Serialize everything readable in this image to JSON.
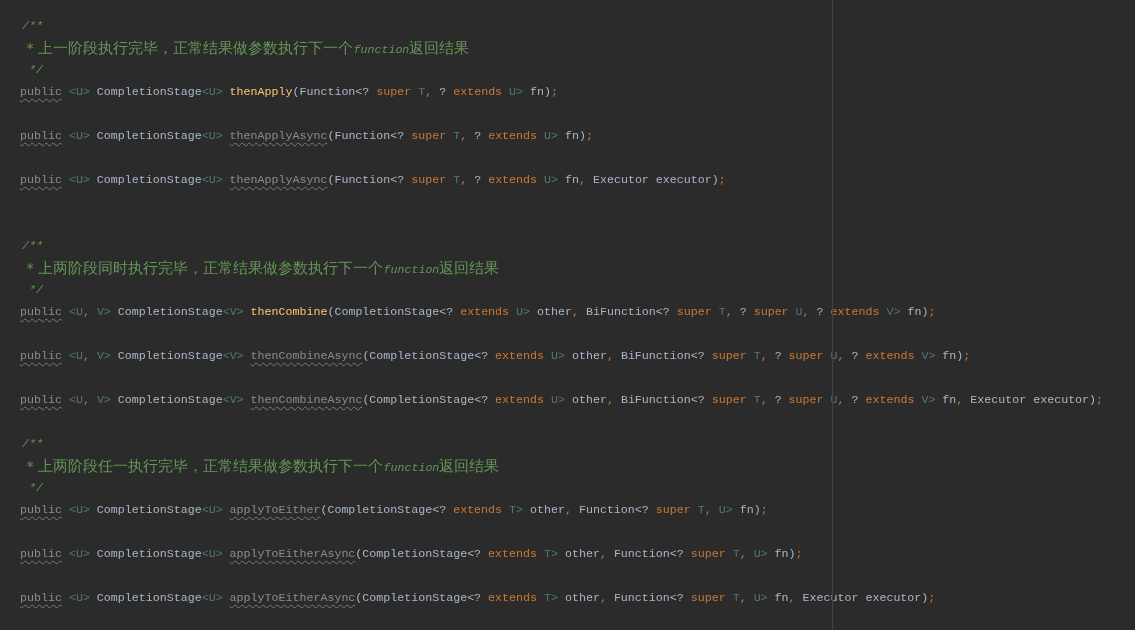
{
  "editor": {
    "lines": [
      {
        "kind": "comment",
        "tokens": [
          {
            "text": "/**",
            "kind": "comment_em"
          }
        ]
      },
      {
        "kind": "comment",
        "tokens": [
          {
            "text": " * 上一阶段执行完毕，正常结果做参数执行下一个",
            "kind": "comment"
          },
          {
            "text": "function",
            "kind": "comment_em"
          },
          {
            "text": "返回结果",
            "kind": "comment"
          }
        ]
      },
      {
        "kind": "comment",
        "tokens": [
          {
            "text": " */",
            "kind": "comment_em"
          }
        ]
      },
      {
        "kind": "code",
        "tokens": [
          {
            "text": "public",
            "kind": "warn"
          },
          {
            "text": " <U>",
            "kind": "type"
          },
          {
            "text": " CompletionStage",
            "kind": "plain"
          },
          {
            "text": "<U> ",
            "kind": "type"
          },
          {
            "text": "thenApply",
            "kind": "method"
          },
          {
            "text": "(Function<? ",
            "kind": "plain"
          },
          {
            "text": "super",
            "kind": "kw"
          },
          {
            "text": " T",
            "kind": "type"
          },
          {
            "text": ",",
            "kind": "punct"
          },
          {
            "text": " ? ",
            "kind": "plain"
          },
          {
            "text": "extends",
            "kind": "kw"
          },
          {
            "text": " U>",
            "kind": "type"
          },
          {
            "text": " fn)",
            "kind": "plain"
          },
          {
            "text": ";",
            "kind": "punct"
          }
        ]
      },
      {
        "kind": "blank"
      },
      {
        "kind": "code",
        "tokens": [
          {
            "text": "public",
            "kind": "warn"
          },
          {
            "text": " <U>",
            "kind": "type"
          },
          {
            "text": " CompletionStage",
            "kind": "plain"
          },
          {
            "text": "<U> ",
            "kind": "type"
          },
          {
            "text": "thenApplyAsync",
            "kind": "method_unused"
          },
          {
            "text": "(Function<? ",
            "kind": "plain"
          },
          {
            "text": "super",
            "kind": "kw"
          },
          {
            "text": " T",
            "kind": "type"
          },
          {
            "text": ",",
            "kind": "punct"
          },
          {
            "text": " ? ",
            "kind": "plain"
          },
          {
            "text": "extends",
            "kind": "kw"
          },
          {
            "text": " U>",
            "kind": "type"
          },
          {
            "text": " fn)",
            "kind": "plain"
          },
          {
            "text": ";",
            "kind": "punct"
          }
        ]
      },
      {
        "kind": "blank"
      },
      {
        "kind": "code",
        "tokens": [
          {
            "text": "public",
            "kind": "warn"
          },
          {
            "text": " <U>",
            "kind": "type"
          },
          {
            "text": " CompletionStage",
            "kind": "plain"
          },
          {
            "text": "<U> ",
            "kind": "type"
          },
          {
            "text": "thenApplyAsync",
            "kind": "method_unused"
          },
          {
            "text": "(Function<? ",
            "kind": "plain"
          },
          {
            "text": "super",
            "kind": "kw"
          },
          {
            "text": " T",
            "kind": "type"
          },
          {
            "text": ",",
            "kind": "punct"
          },
          {
            "text": " ? ",
            "kind": "plain"
          },
          {
            "text": "extends",
            "kind": "kw"
          },
          {
            "text": " U>",
            "kind": "type"
          },
          {
            "text": " fn",
            "kind": "plain"
          },
          {
            "text": ",",
            "kind": "punct"
          },
          {
            "text": " Executor executor)",
            "kind": "plain"
          },
          {
            "text": ";",
            "kind": "punct"
          }
        ]
      },
      {
        "kind": "blank"
      },
      {
        "kind": "blank"
      },
      {
        "kind": "comment",
        "tokens": [
          {
            "text": "/**",
            "kind": "comment_em"
          }
        ]
      },
      {
        "kind": "comment",
        "tokens": [
          {
            "text": " * 上两阶段同时执行完毕，正常结果做参数执行下一个",
            "kind": "comment"
          },
          {
            "text": "function",
            "kind": "comment_em"
          },
          {
            "text": "返回结果",
            "kind": "comment"
          }
        ]
      },
      {
        "kind": "comment",
        "tokens": [
          {
            "text": " */",
            "kind": "comment_em"
          }
        ]
      },
      {
        "kind": "code",
        "tokens": [
          {
            "text": "public",
            "kind": "warn"
          },
          {
            "text": " <U",
            "kind": "type"
          },
          {
            "text": ",",
            "kind": "punct"
          },
          {
            "text": " V>",
            "kind": "type"
          },
          {
            "text": " CompletionStage",
            "kind": "plain"
          },
          {
            "text": "<V> ",
            "kind": "type"
          },
          {
            "text": "thenCombine",
            "kind": "method"
          },
          {
            "text": "(CompletionStage<? ",
            "kind": "plain"
          },
          {
            "text": "extends",
            "kind": "kw"
          },
          {
            "text": " U>",
            "kind": "type"
          },
          {
            "text": " other",
            "kind": "plain"
          },
          {
            "text": ",",
            "kind": "punct"
          },
          {
            "text": " BiFunction<? ",
            "kind": "plain"
          },
          {
            "text": "super",
            "kind": "kw"
          },
          {
            "text": " T",
            "kind": "type"
          },
          {
            "text": ",",
            "kind": "punct"
          },
          {
            "text": " ? ",
            "kind": "plain"
          },
          {
            "text": "super",
            "kind": "kw"
          },
          {
            "text": " U",
            "kind": "type"
          },
          {
            "text": ",",
            "kind": "punct"
          },
          {
            "text": " ? ",
            "kind": "plain"
          },
          {
            "text": "extends",
            "kind": "kw"
          },
          {
            "text": " V>",
            "kind": "type"
          },
          {
            "text": " fn)",
            "kind": "plain"
          },
          {
            "text": ";",
            "kind": "punct"
          }
        ]
      },
      {
        "kind": "blank"
      },
      {
        "kind": "code",
        "tokens": [
          {
            "text": "public",
            "kind": "warn"
          },
          {
            "text": " <U",
            "kind": "type"
          },
          {
            "text": ",",
            "kind": "punct"
          },
          {
            "text": " V>",
            "kind": "type"
          },
          {
            "text": " CompletionStage",
            "kind": "plain"
          },
          {
            "text": "<V> ",
            "kind": "type"
          },
          {
            "text": "thenCombineAsync",
            "kind": "method_unused"
          },
          {
            "text": "(CompletionStage<? ",
            "kind": "plain"
          },
          {
            "text": "extends",
            "kind": "kw"
          },
          {
            "text": " U>",
            "kind": "type"
          },
          {
            "text": " other",
            "kind": "plain"
          },
          {
            "text": ",",
            "kind": "punct"
          },
          {
            "text": " BiFunction<? ",
            "kind": "plain"
          },
          {
            "text": "super",
            "kind": "kw"
          },
          {
            "text": " T",
            "kind": "type"
          },
          {
            "text": ",",
            "kind": "punct"
          },
          {
            "text": " ? ",
            "kind": "plain"
          },
          {
            "text": "super",
            "kind": "kw"
          },
          {
            "text": " U",
            "kind": "type"
          },
          {
            "text": ",",
            "kind": "punct"
          },
          {
            "text": " ? ",
            "kind": "plain"
          },
          {
            "text": "extends",
            "kind": "kw"
          },
          {
            "text": " V>",
            "kind": "type"
          },
          {
            "text": " fn)",
            "kind": "plain"
          },
          {
            "text": ";",
            "kind": "punct"
          }
        ]
      },
      {
        "kind": "blank"
      },
      {
        "kind": "code",
        "tokens": [
          {
            "text": "public",
            "kind": "warn"
          },
          {
            "text": " <U",
            "kind": "type"
          },
          {
            "text": ",",
            "kind": "punct"
          },
          {
            "text": " V>",
            "kind": "type"
          },
          {
            "text": " CompletionStage",
            "kind": "plain"
          },
          {
            "text": "<V> ",
            "kind": "type"
          },
          {
            "text": "thenCombineAsync",
            "kind": "method_unused"
          },
          {
            "text": "(CompletionStage<? ",
            "kind": "plain"
          },
          {
            "text": "extends",
            "kind": "kw"
          },
          {
            "text": " U>",
            "kind": "type"
          },
          {
            "text": " other",
            "kind": "plain"
          },
          {
            "text": ",",
            "kind": "punct"
          },
          {
            "text": " BiFunction<? ",
            "kind": "plain"
          },
          {
            "text": "super",
            "kind": "kw"
          },
          {
            "text": " T",
            "kind": "type"
          },
          {
            "text": ",",
            "kind": "punct"
          },
          {
            "text": " ? ",
            "kind": "plain"
          },
          {
            "text": "super",
            "kind": "kw"
          },
          {
            "text": " U",
            "kind": "type"
          },
          {
            "text": ",",
            "kind": "punct"
          },
          {
            "text": " ? ",
            "kind": "plain"
          },
          {
            "text": "extends",
            "kind": "kw"
          },
          {
            "text": " V>",
            "kind": "type"
          },
          {
            "text": " fn",
            "kind": "plain"
          },
          {
            "text": ",",
            "kind": "punct"
          },
          {
            "text": " Executor executor)",
            "kind": "plain"
          },
          {
            "text": ";",
            "kind": "punct"
          }
        ]
      },
      {
        "kind": "blank"
      },
      {
        "kind": "comment",
        "tokens": [
          {
            "text": "/**",
            "kind": "comment_em"
          }
        ]
      },
      {
        "kind": "comment",
        "tokens": [
          {
            "text": " * 上两阶段任一执行完毕，正常结果做参数执行下一个",
            "kind": "comment"
          },
          {
            "text": "function",
            "kind": "comment_em"
          },
          {
            "text": "返回结果",
            "kind": "comment"
          }
        ]
      },
      {
        "kind": "comment",
        "tokens": [
          {
            "text": " */",
            "kind": "comment_em"
          }
        ]
      },
      {
        "kind": "code",
        "tokens": [
          {
            "text": "public",
            "kind": "warn"
          },
          {
            "text": " <U>",
            "kind": "type"
          },
          {
            "text": " CompletionStage",
            "kind": "plain"
          },
          {
            "text": "<U> ",
            "kind": "type"
          },
          {
            "text": "applyToEither",
            "kind": "method_unused"
          },
          {
            "text": "(CompletionStage<? ",
            "kind": "plain"
          },
          {
            "text": "extends",
            "kind": "kw"
          },
          {
            "text": " T>",
            "kind": "type"
          },
          {
            "text": " other",
            "kind": "plain"
          },
          {
            "text": ",",
            "kind": "punct"
          },
          {
            "text": " Function<? ",
            "kind": "plain"
          },
          {
            "text": "super",
            "kind": "kw"
          },
          {
            "text": " T",
            "kind": "type"
          },
          {
            "text": ",",
            "kind": "punct"
          },
          {
            "text": " U>",
            "kind": "type"
          },
          {
            "text": " fn)",
            "kind": "plain"
          },
          {
            "text": ";",
            "kind": "punct"
          }
        ]
      },
      {
        "kind": "blank"
      },
      {
        "kind": "code",
        "tokens": [
          {
            "text": "public",
            "kind": "warn"
          },
          {
            "text": " <U>",
            "kind": "type"
          },
          {
            "text": " CompletionStage",
            "kind": "plain"
          },
          {
            "text": "<U> ",
            "kind": "type"
          },
          {
            "text": "applyToEitherAsync",
            "kind": "method_unused"
          },
          {
            "text": "(CompletionStage<? ",
            "kind": "plain"
          },
          {
            "text": "extends",
            "kind": "kw"
          },
          {
            "text": " T>",
            "kind": "type"
          },
          {
            "text": " other",
            "kind": "plain"
          },
          {
            "text": ",",
            "kind": "punct"
          },
          {
            "text": " Function<? ",
            "kind": "plain"
          },
          {
            "text": "super",
            "kind": "kw"
          },
          {
            "text": " T",
            "kind": "type"
          },
          {
            "text": ",",
            "kind": "punct"
          },
          {
            "text": " U>",
            "kind": "type"
          },
          {
            "text": " fn)",
            "kind": "plain"
          },
          {
            "text": ";",
            "kind": "punct"
          }
        ]
      },
      {
        "kind": "blank"
      },
      {
        "kind": "code",
        "tokens": [
          {
            "text": "public",
            "kind": "warn"
          },
          {
            "text": " <U>",
            "kind": "type"
          },
          {
            "text": " CompletionStage",
            "kind": "plain"
          },
          {
            "text": "<U> ",
            "kind": "type"
          },
          {
            "text": "applyToEitherAsync",
            "kind": "method_unused"
          },
          {
            "text": "(CompletionStage<? ",
            "kind": "plain"
          },
          {
            "text": "extends",
            "kind": "kw"
          },
          {
            "text": " T>",
            "kind": "type"
          },
          {
            "text": " other",
            "kind": "plain"
          },
          {
            "text": ",",
            "kind": "punct"
          },
          {
            "text": " Function<? ",
            "kind": "plain"
          },
          {
            "text": "super",
            "kind": "kw"
          },
          {
            "text": " T",
            "kind": "type"
          },
          {
            "text": ",",
            "kind": "punct"
          },
          {
            "text": " U>",
            "kind": "type"
          },
          {
            "text": " fn",
            "kind": "plain"
          },
          {
            "text": ",",
            "kind": "punct"
          },
          {
            "text": " Executor executor)",
            "kind": "plain"
          },
          {
            "text": ";",
            "kind": "punct"
          }
        ]
      }
    ]
  }
}
